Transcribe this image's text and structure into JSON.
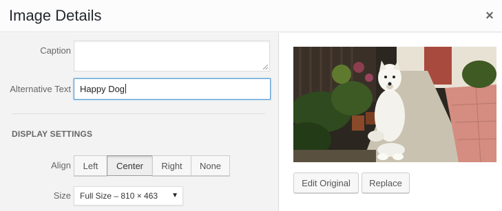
{
  "header": {
    "title": "Image Details",
    "close_glyph": "×"
  },
  "settings": {
    "caption": {
      "label": "Caption",
      "value": ""
    },
    "alt_text": {
      "label": "Alternative Text",
      "value": "Happy Dog"
    },
    "display_settings": {
      "heading": "DISPLAY SETTINGS",
      "align": {
        "label": "Align",
        "options": [
          "Left",
          "Center",
          "Right",
          "None"
        ],
        "selected": "Center"
      },
      "size": {
        "label": "Size",
        "selected": "Full Size – 810 × 463",
        "arrow": "▼"
      }
    }
  },
  "image_panel": {
    "image_icon": "dog-photo",
    "buttons": {
      "edit_original": "Edit Original",
      "replace": "Replace"
    }
  },
  "colors": {
    "focus_border": "#5b9dd9",
    "panel_bg": "#f3f3f3"
  }
}
